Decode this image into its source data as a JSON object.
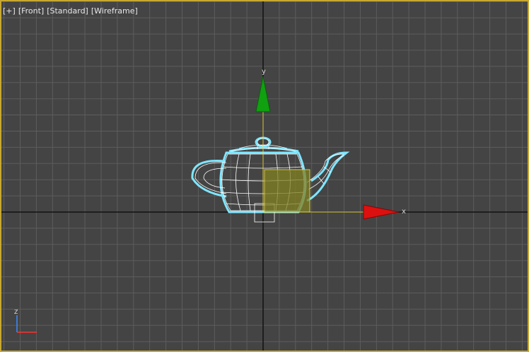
{
  "viewport": {
    "label_parts": [
      "[+]",
      "[Front]",
      "[Standard]",
      "[Wireframe]"
    ]
  },
  "gizmo": {
    "x_label": "x",
    "y_label": "y"
  },
  "view_axes": {
    "vertical_label": "Z"
  },
  "colors": {
    "viewport_background": "#444444",
    "viewport_border": "#c8a832",
    "grid_line": "#5d5d5d",
    "world_axis": "#111111",
    "selection_wire": "#7fe6ff",
    "mesh_wire": "#ffffff",
    "gizmo_x": "#dd1010",
    "gizmo_y": "#10a010",
    "gizmo_plane": "#808020",
    "gizmo_line": "#f0e050"
  }
}
